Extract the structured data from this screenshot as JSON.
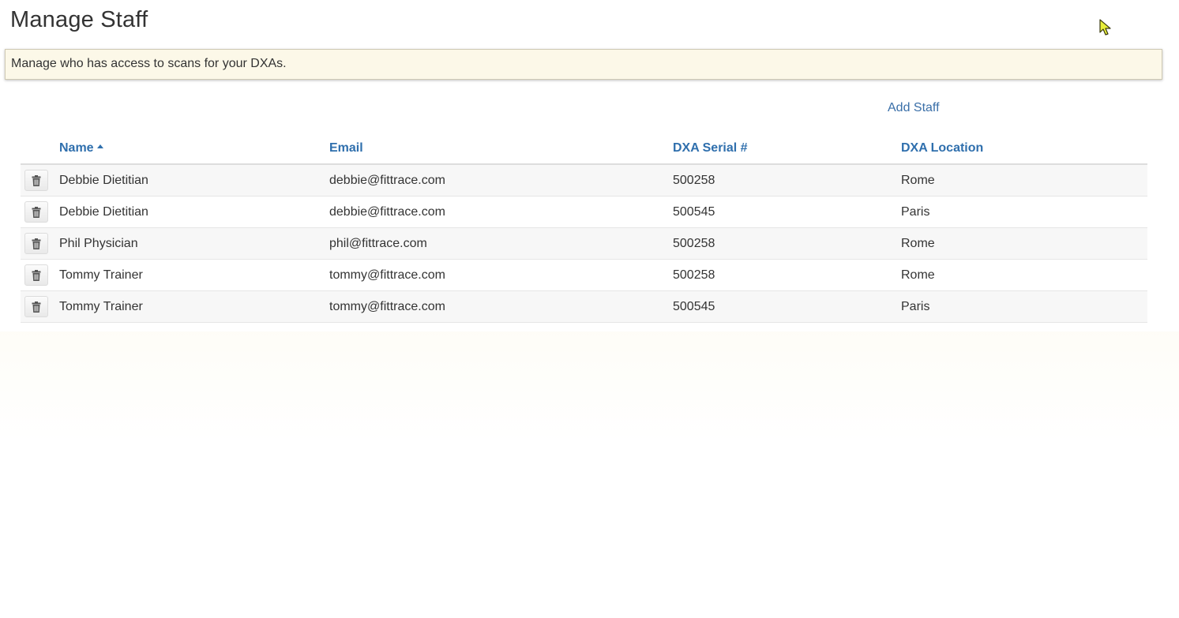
{
  "header": {
    "title": "Manage Staff"
  },
  "notice": {
    "text": "Manage who has access to scans for your DXAs."
  },
  "actions": {
    "add_staff_label": "Add Staff"
  },
  "table": {
    "columns": {
      "name": "Name",
      "email": "Email",
      "serial": "DXA Serial #",
      "location": "DXA Location"
    },
    "sort": {
      "column": "name",
      "direction": "ascending"
    },
    "rows": [
      {
        "name": "Debbie Dietitian",
        "email": "debbie@fittrace.com",
        "serial": "500258",
        "location": "Rome"
      },
      {
        "name": "Debbie Dietitian",
        "email": "debbie@fittrace.com",
        "serial": "500545",
        "location": "Paris"
      },
      {
        "name": "Phil Physician",
        "email": "phil@fittrace.com",
        "serial": "500258",
        "location": "Rome"
      },
      {
        "name": "Tommy Trainer",
        "email": "tommy@fittrace.com",
        "serial": "500258",
        "location": "Rome"
      },
      {
        "name": "Tommy Trainer",
        "email": "tommy@fittrace.com",
        "serial": "500545",
        "location": "Paris"
      }
    ]
  },
  "icons": {
    "row_action": "trash-icon",
    "sort_indicator": "sort-ascending-icon",
    "pointer": "mouse-cursor-icon"
  },
  "colors": {
    "link": "#3a6fa8",
    "header_text": "#2f6fad",
    "notice_background": "#fcf8e8"
  }
}
